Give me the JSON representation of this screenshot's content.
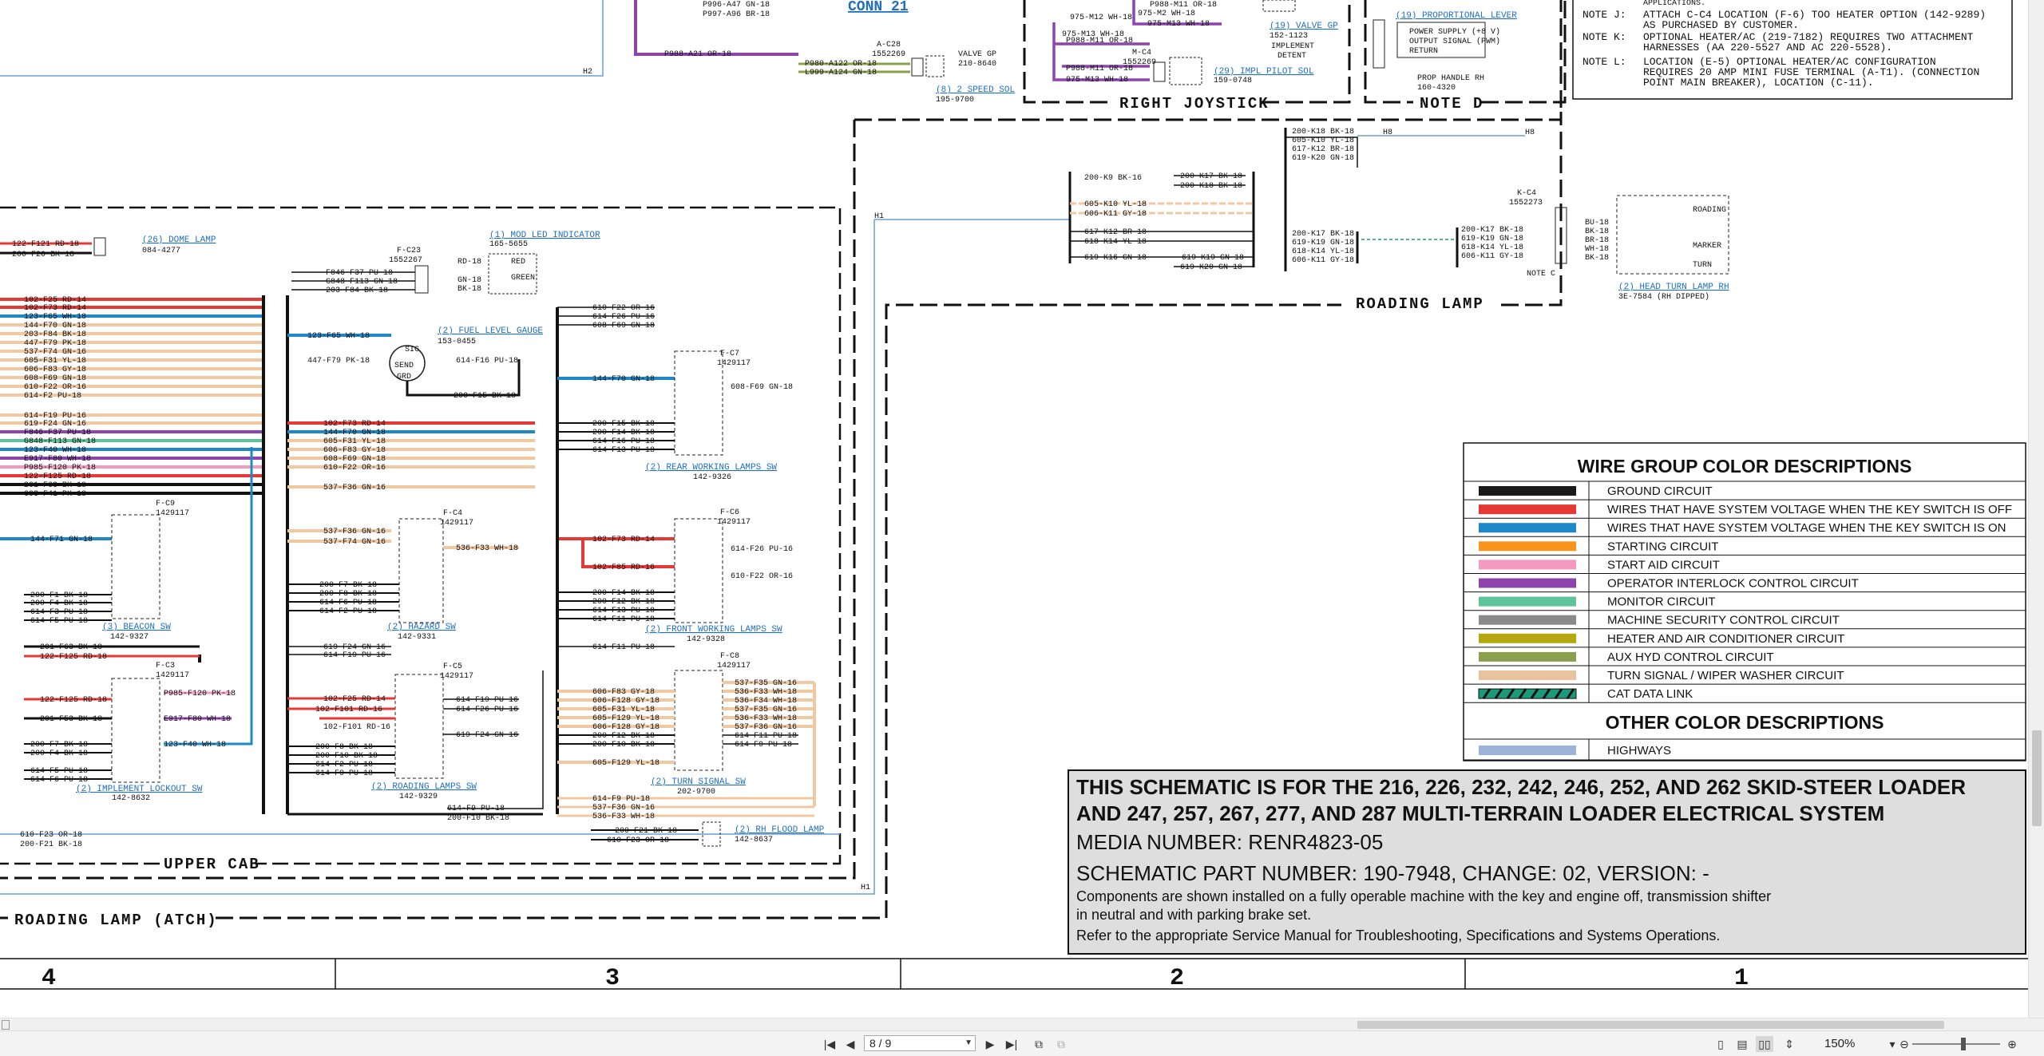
{
  "schematic": {
    "frame_labels": {
      "right_joystick": "RIGHT JOYSTICK",
      "note_d": "NOTE D",
      "roading_lamp": "ROADING LAMP",
      "upper_cab": "UPPER CAB",
      "roading_lamp_atch": "ROADING LAMP (ATCH)"
    },
    "notes": [
      {
        "key": "NOTE J:",
        "text": "ATTACH C-C4 LOCATION (F-6) TOO HEATER OPTION (142-9289)",
        "cont": "AS PURCHASED BY CUSTOMER."
      },
      {
        "key": "NOTE K:",
        "text": "OPTIONAL HEATER/AC (219-7182) REQUIRES TWO ATTACHMENT",
        "cont": "HARNESSES (AA 220-5527 AND AC 220-5528)."
      },
      {
        "key": "NOTE L:",
        "text": "LOCATION (E-5) OPTIONAL HEATER/AC CONFIGURATION",
        "cont": "REQUIRES 20 AMP MINI FUSE TERMINAL (A-T1). (CONNECTION",
        "cont2": "POINT MAIN BREAKER), LOCATION (C-11)."
      }
    ],
    "notes_top": "APPLICATIONS.",
    "components": {
      "conn21": "CONN 21",
      "dome_lamp": "(26) DOME LAMP",
      "dome_lamp_pn": "084-4277",
      "mod_led": "(1) MOD LED INDICATOR",
      "mod_led_pn": "165-5655",
      "fuel_gauge": "(2) FUEL LEVEL GAUGE",
      "fuel_gauge_pn": "153-0455",
      "beacon_sw": "(3) BEACON SW",
      "beacon_sw_pn": "142-9327",
      "hazard_sw": "(2) HAZARD SW",
      "hazard_sw_pn": "142-9331",
      "impl_lockout_sw": "(2) IMPLEMENT LOCKOUT SW",
      "impl_lockout_sw_pn": "142-8632",
      "roading_sw": "(2) ROADING LAMPS SW",
      "roading_sw_pn": "142-9329",
      "rear_work_sw": "(2) REAR WORKING LAMPS SW",
      "rear_work_sw_pn": "142-9326",
      "front_work_sw": "(2) FRONT WORKING LAMPS SW",
      "front_work_sw_pn": "142-9328",
      "turn_signal_sw": "(2) TURN SIGNAL SW",
      "turn_signal_sw_pn": "202-9700",
      "rh_flood": "(2) RH FLOOD LAMP",
      "rh_flood_pn": "142-8637",
      "speed_sol": "(8) 2 SPEED SOL",
      "speed_sol_pn": "195-9700",
      "valve_gp": "VALVE GP",
      "valve_gp_pn": "210-8640",
      "valve_gp2": "(19) VALVE GP",
      "valve_gp2_pn": "152-1123",
      "impl_detent": "IMPLEMENT DETENT",
      "impl_pilot_sol": "(29) IMPL PILOT SOL",
      "impl_pilot_sol_pn": "159-0748",
      "prop_lever": "(19) PROPORTIONAL LEVER",
      "prop_handle": "PROP HANDLE RH",
      "prop_handle_pn": "160-4320",
      "prop_pins": [
        "POWER SUPPLY (+8 V)",
        "OUTPUT SIGNAL (PWM)",
        "RETURN"
      ],
      "head_turn_lamp": "(2) HEAD TURN LAMP RH",
      "head_turn_lamp_pn": "3E-7584 (RH DIPPED)",
      "lamp_labels": [
        "ROADING",
        "MARKER",
        "TURN"
      ],
      "note_c": "NOTE C"
    },
    "connectors": {
      "fc23": "F-C23",
      "fc23_pn": "1552267",
      "ac28": "A-C28",
      "ac28_pn": "1552269",
      "mc4": "M-C4",
      "mc4_pn": "1552269",
      "kc4": "K-C4",
      "kc4_pn": "1552273",
      "fc9": "F-C9",
      "fc4": "F-C4",
      "fc3": "F-C3",
      "fc5": "F-C5",
      "fc7": "F-C7",
      "fc6": "F-C6",
      "fc8": "F-C8",
      "sw_pn": "1429117",
      "send": "SEND",
      "grd": "GRD",
      "sig": "SIG",
      "red": "RED",
      "green": "GREEN"
    },
    "harness_marks": {
      "h1": "H1",
      "h2": "H2",
      "h8": "H8"
    },
    "zones": [
      "4",
      "3",
      "2",
      "1"
    ]
  },
  "legend": {
    "title": "WIRE GROUP COLOR DESCRIPTIONS",
    "items": [
      {
        "label": "GROUND CIRCUIT",
        "color": "#1a1a1a"
      },
      {
        "label": "WIRES THAT HAVE SYSTEM VOLTAGE WHEN THE KEY SWITCH IS OFF",
        "color": "#e53935"
      },
      {
        "label": "WIRES THAT HAVE SYSTEM VOLTAGE WHEN THE KEY SWITCH IS ON",
        "color": "#1f88c8"
      },
      {
        "label": "STARTING CIRCUIT",
        "color": "#f7941d"
      },
      {
        "label": "START AID CIRCUIT",
        "color": "#f49ac1"
      },
      {
        "label": "OPERATOR INTERLOCK CONTROL CIRCUIT",
        "color": "#8e44ad"
      },
      {
        "label": "MONITOR CIRCUIT",
        "color": "#5fc39a"
      },
      {
        "label": "MACHINE SECURITY CONTROL CIRCUIT",
        "color": "#8a8a8a"
      },
      {
        "label": "HEATER AND AIR CONDITIONER CIRCUIT",
        "color": "#b5a80e"
      },
      {
        "label": "AUX HYD CONTROL CIRCUIT",
        "color": "#8aa04c"
      },
      {
        "label": "TURN SIGNAL / WIPER WASHER CIRCUIT",
        "color": "#e8c39e"
      },
      {
        "label": "CAT DATA LINK",
        "color": "#1a9a7a"
      }
    ],
    "other_title": "OTHER COLOR DESCRIPTIONS",
    "other_items": [
      {
        "label": "HIGHWAYS",
        "color": "#9db4d8"
      }
    ]
  },
  "title_block": {
    "line1": "THIS SCHEMATIC IS FOR THE 216, 226, 232, 242, 246, 252, AND 262 SKID-STEER LOADER",
    "line2": "AND 247, 257, 267, 277, AND 287 MULTI-TERRAIN LOADER ELECTRICAL SYSTEM",
    "media": "MEDIA NUMBER: RENR4823-05",
    "part": "SCHEMATIC PART NUMBER: 190-7948, CHANGE: 02, VERSION: -",
    "desc1": "Components are shown installed on a fully operable machine with the key and engine off, transmission shifter",
    "desc2": "in neutral and with parking brake set.",
    "desc3": "Refer to the appropriate Service Manual for Troubleshooting, Specifications and Systems Operations."
  },
  "toolbar": {
    "page": "8 / 9",
    "zoom": "150%"
  }
}
